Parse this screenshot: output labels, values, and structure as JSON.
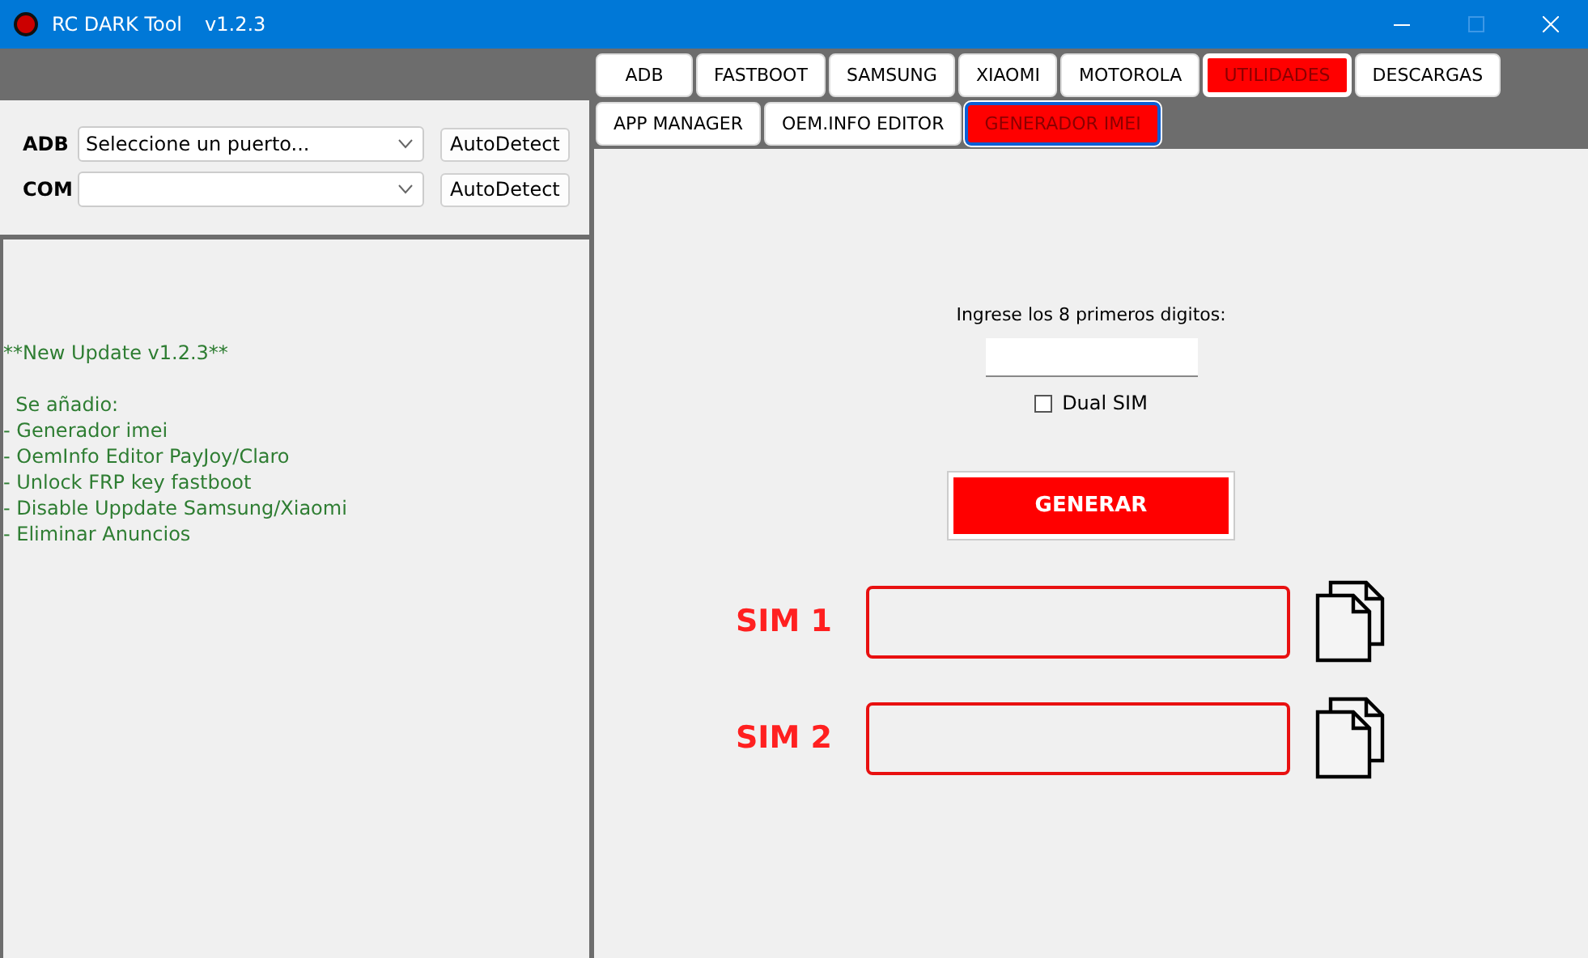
{
  "window": {
    "title": "RC DARK Tool",
    "version": "v1.2.3"
  },
  "ports": [
    {
      "label": "ADB",
      "value": "Seleccione un puerto...",
      "button": "AutoDetect"
    },
    {
      "label": "COM",
      "button": "AutoDetect"
    }
  ],
  "changelog": {
    "heading": "**New Update v1.2.3**",
    "subheading": "  Se añadio:",
    "lines": [
      "- Generador imei",
      "- OemInfo Editor PayJoy/Claro",
      "- Unlock FRP key fastboot",
      "- Disable Uppdate Samsung/Xiaomi",
      "- Eliminar Anuncios"
    ]
  },
  "tabs": [
    {
      "label": "ADB",
      "selected": false
    },
    {
      "label": "FASTBOOT",
      "selected": false
    },
    {
      "label": "SAMSUNG",
      "selected": false
    },
    {
      "label": "XIAOMI",
      "selected": false
    },
    {
      "label": "MOTOROLA",
      "selected": false
    },
    {
      "label": "UTILIDADES",
      "selected": true
    },
    {
      "label": "DESCARGAS",
      "selected": false
    }
  ],
  "subtabs": [
    {
      "label": "APP MANAGER",
      "selected": false
    },
    {
      "label": "OEM.INFO EDITOR",
      "selected": false
    },
    {
      "label": "GENERADOR IMEI",
      "selected": true
    }
  ],
  "generator": {
    "prompt": "Ingrese los 8 primeros digitos:",
    "dual_sim": {
      "label": "Dual SIM",
      "checked": false
    },
    "button": "GENERAR",
    "outputs": [
      {
        "label": "SIM 1"
      },
      {
        "label": "SIM 2"
      }
    ]
  }
}
